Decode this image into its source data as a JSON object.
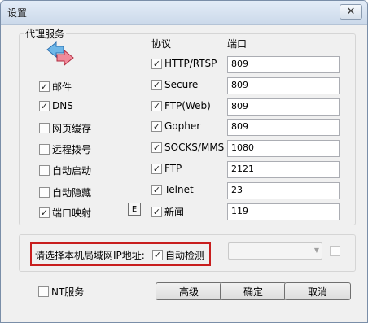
{
  "window": {
    "title": "设置",
    "close_glyph": "✕"
  },
  "proxy": {
    "group_title": "代理服务",
    "icon": "swap-arrows-icon",
    "left_options": [
      {
        "label": "邮件",
        "checked": true
      },
      {
        "label": "DNS",
        "checked": true
      },
      {
        "label": "网页缓存",
        "checked": false
      },
      {
        "label": "远程拨号",
        "checked": false
      },
      {
        "label": "自动启动",
        "checked": false
      },
      {
        "label": "自动隐藏",
        "checked": false
      },
      {
        "label": "端口映射",
        "checked": true
      }
    ],
    "e_button": "E",
    "protocol_header": "协议",
    "port_header": "端口",
    "protocols": [
      {
        "label": "HTTP/RTSP",
        "checked": true,
        "port": "809"
      },
      {
        "label": "Secure",
        "checked": true,
        "port": "809"
      },
      {
        "label": "FTP(Web)",
        "checked": true,
        "port": "809"
      },
      {
        "label": "Gopher",
        "checked": true,
        "port": "809"
      },
      {
        "label": "SOCKS/MMS",
        "checked": true,
        "port": "1080"
      },
      {
        "label": "FTP",
        "checked": true,
        "port": "2121"
      },
      {
        "label": "Telnet",
        "checked": true,
        "port": "23"
      },
      {
        "label": "新闻",
        "checked": true,
        "port": "119"
      }
    ]
  },
  "lan": {
    "label": "请选择本机局域网IP地址:",
    "auto_detect": "自动检测",
    "auto_detect_checked": true,
    "ip_value": ""
  },
  "bottom": {
    "nt_service": "NT服务",
    "nt_checked": false,
    "advanced": "高级",
    "ok": "确定",
    "cancel": "取消"
  },
  "colors": {
    "highlight_border": "#c81e1e",
    "title_bar": "#cbd9ea"
  }
}
